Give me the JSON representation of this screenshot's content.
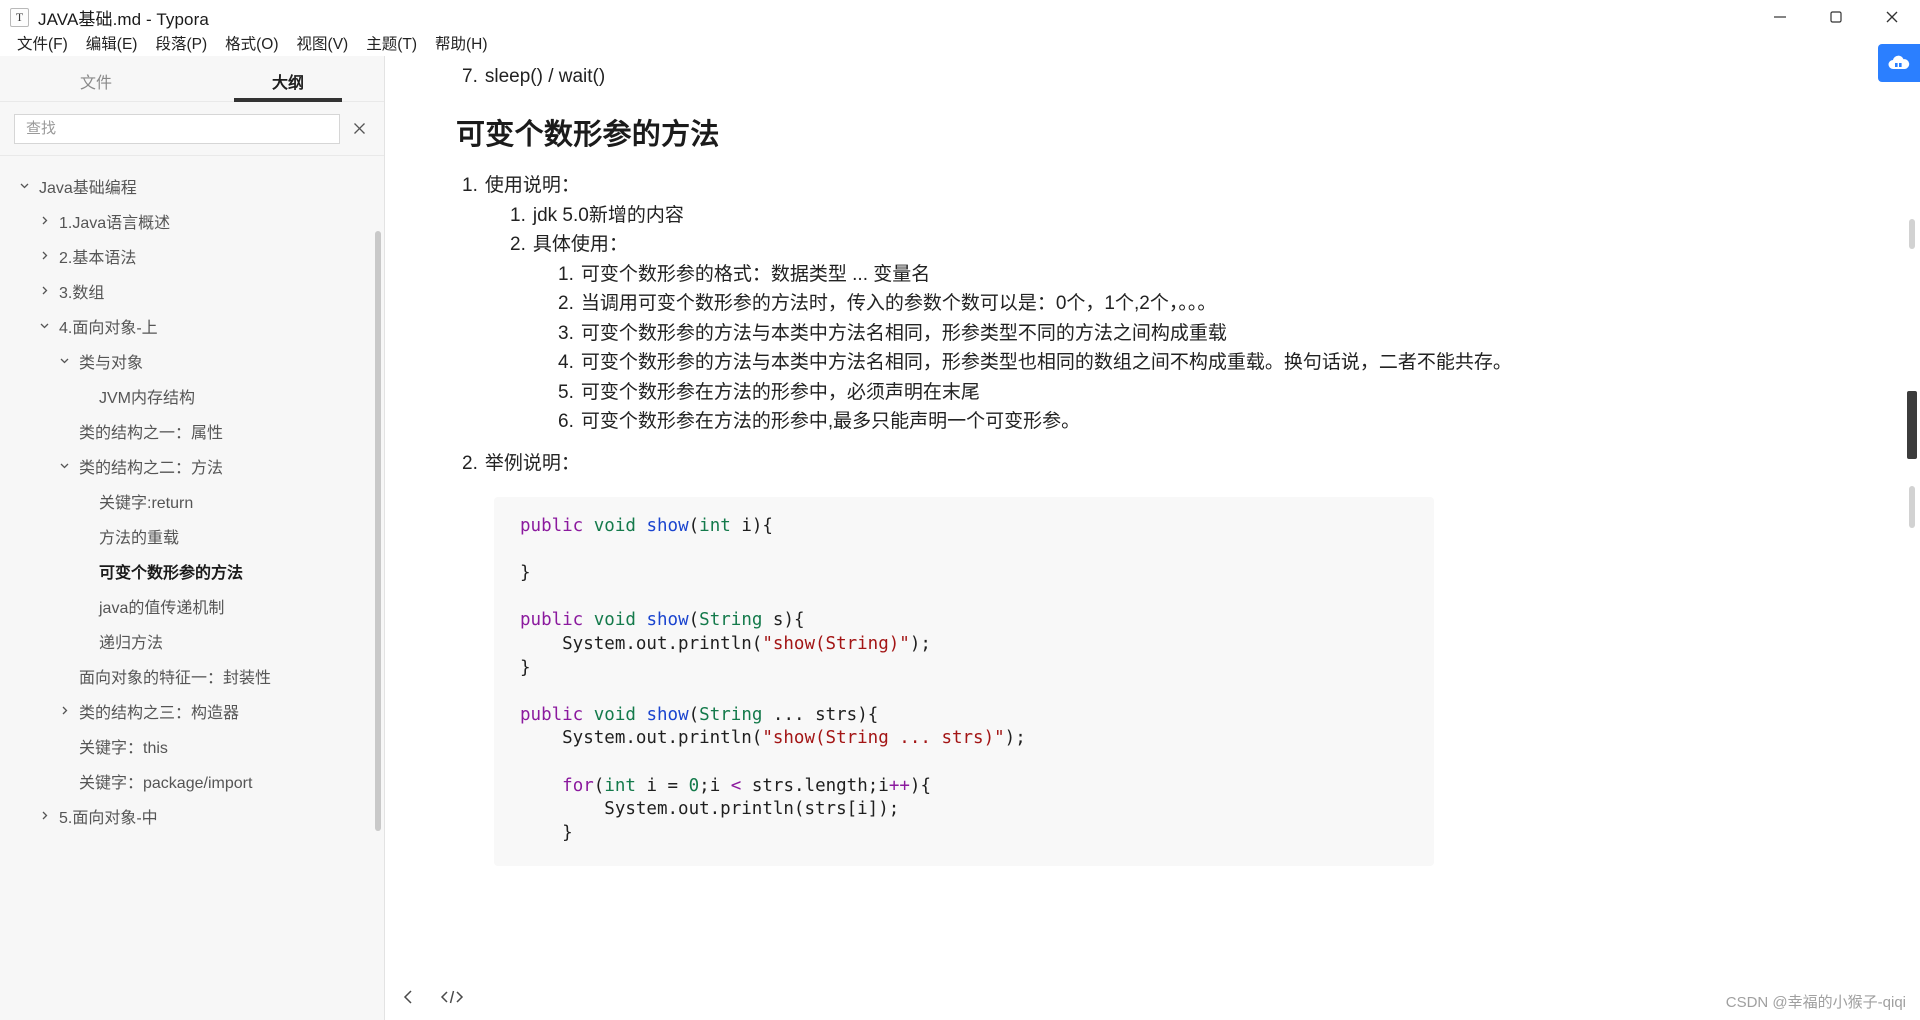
{
  "window": {
    "title": "JAVA基础.md - Typora",
    "doc_icon_letter": "T",
    "controls": {
      "minimize": "minimize-icon",
      "maximize": "maximize-icon",
      "close": "close-icon"
    }
  },
  "menubar": {
    "items": [
      {
        "label": "文件(F)",
        "name": "menu-file"
      },
      {
        "label": "编辑(E)",
        "name": "menu-edit"
      },
      {
        "label": "段落(P)",
        "name": "menu-paragraph"
      },
      {
        "label": "格式(O)",
        "name": "menu-format"
      },
      {
        "label": "视图(V)",
        "name": "menu-view"
      },
      {
        "label": "主题(T)",
        "name": "menu-theme"
      },
      {
        "label": "帮助(H)",
        "name": "menu-help"
      }
    ]
  },
  "sidebar": {
    "tabs": [
      {
        "label": "文件",
        "active": false
      },
      {
        "label": "大纲",
        "active": true
      }
    ],
    "search": {
      "placeholder": "查找",
      "value": "",
      "close_icon": "close-icon"
    },
    "tree": [
      {
        "label": "Java基础编程",
        "depth": 0,
        "caret": "down",
        "active": false
      },
      {
        "label": "1.Java语言概述",
        "depth": 1,
        "caret": "right",
        "active": false
      },
      {
        "label": "2.基本语法",
        "depth": 1,
        "caret": "right",
        "active": false
      },
      {
        "label": "3.数组",
        "depth": 1,
        "caret": "right",
        "active": false
      },
      {
        "label": "4.面向对象-上",
        "depth": 1,
        "caret": "down",
        "active": false
      },
      {
        "label": "类与对象",
        "depth": 2,
        "caret": "down",
        "active": false
      },
      {
        "label": "JVM内存结构",
        "depth": 3,
        "caret": "none",
        "active": false
      },
      {
        "label": "类的结构之一：属性",
        "depth": 2,
        "caret": "none",
        "active": false
      },
      {
        "label": "类的结构之二：方法",
        "depth": 2,
        "caret": "down",
        "active": false
      },
      {
        "label": "关键字:return",
        "depth": 3,
        "caret": "none",
        "active": false
      },
      {
        "label": "方法的重载",
        "depth": 3,
        "caret": "none",
        "active": false
      },
      {
        "label": "可变个数形参的方法",
        "depth": 3,
        "caret": "none",
        "active": true
      },
      {
        "label": "java的值传递机制",
        "depth": 3,
        "caret": "none",
        "active": false
      },
      {
        "label": "递归方法",
        "depth": 3,
        "caret": "none",
        "active": false
      },
      {
        "label": "面向对象的特征一：封装性",
        "depth": 2,
        "caret": "none",
        "active": false
      },
      {
        "label": "类的结构之三：构造器",
        "depth": 2,
        "caret": "right",
        "active": false
      },
      {
        "label": "关键字：this",
        "depth": 2,
        "caret": "none",
        "active": false
      },
      {
        "label": "关键字：package/import",
        "depth": 2,
        "caret": "none",
        "active": false
      },
      {
        "label": "5.面向对象-中",
        "depth": 1,
        "caret": "right",
        "active": false
      }
    ]
  },
  "document": {
    "prev_item": {
      "num": "7.",
      "text": "sleep() / wait()"
    },
    "heading": "可变个数形参的方法",
    "sections": [
      {
        "num": "1.",
        "text": "使用说明：",
        "children": [
          {
            "num": "1.",
            "text": "jdk 5.0新增的内容",
            "children": []
          },
          {
            "num": "2.",
            "text": "具体使用：",
            "children": [
              {
                "num": "1.",
                "text": "可变个数形参的格式：数据类型 ... 变量名"
              },
              {
                "num": "2.",
                "text": "当调用可变个数形参的方法时，传入的参数个数可以是：0个，1个,2个，。。。"
              },
              {
                "num": "3.",
                "text": "可变个数形参的方法与本类中方法名相同，形参类型不同的方法之间构成重载"
              },
              {
                "num": "4.",
                "text": "可变个数形参的方法与本类中方法名相同，形参类型也相同的数组之间不构成重载。换句话说，二者不能共存。"
              },
              {
                "num": "5.",
                "text": "可变个数形参在方法的形参中，必须声明在末尾"
              },
              {
                "num": "6.",
                "text": "可变个数形参在方法的形参中,最多只能声明一个可变形参。"
              }
            ]
          }
        ]
      },
      {
        "num": "2.",
        "text": "举例说明：",
        "children": []
      }
    ],
    "code": {
      "language": "java",
      "lines": [
        [
          {
            "t": "public",
            "c": "k-kw"
          },
          {
            "t": " ",
            "c": "k-plain"
          },
          {
            "t": "void",
            "c": "k-type"
          },
          {
            "t": " ",
            "c": "k-plain"
          },
          {
            "t": "show",
            "c": "k-fn"
          },
          {
            "t": "(",
            "c": "k-plain"
          },
          {
            "t": "int",
            "c": "k-type"
          },
          {
            "t": " i){",
            "c": "k-plain"
          }
        ],
        [],
        [
          {
            "t": "}",
            "c": "k-plain"
          }
        ],
        [],
        [
          {
            "t": "public",
            "c": "k-kw"
          },
          {
            "t": " ",
            "c": "k-plain"
          },
          {
            "t": "void",
            "c": "k-type"
          },
          {
            "t": " ",
            "c": "k-plain"
          },
          {
            "t": "show",
            "c": "k-fn"
          },
          {
            "t": "(",
            "c": "k-plain"
          },
          {
            "t": "String",
            "c": "k-type"
          },
          {
            "t": " s){",
            "c": "k-plain"
          }
        ],
        [
          {
            "t": "    System.out.println(",
            "c": "k-plain"
          },
          {
            "t": "\"show(String)\"",
            "c": "k-str"
          },
          {
            "t": ");",
            "c": "k-plain"
          }
        ],
        [
          {
            "t": "}",
            "c": "k-plain"
          }
        ],
        [],
        [
          {
            "t": "public",
            "c": "k-kw"
          },
          {
            "t": " ",
            "c": "k-plain"
          },
          {
            "t": "void",
            "c": "k-type"
          },
          {
            "t": " ",
            "c": "k-plain"
          },
          {
            "t": "show",
            "c": "k-fn"
          },
          {
            "t": "(",
            "c": "k-plain"
          },
          {
            "t": "String",
            "c": "k-type"
          },
          {
            "t": " ... strs){",
            "c": "k-plain"
          }
        ],
        [
          {
            "t": "    System.out.println(",
            "c": "k-plain"
          },
          {
            "t": "\"show(String ... strs)\"",
            "c": "k-str"
          },
          {
            "t": ");",
            "c": "k-plain"
          }
        ],
        [],
        [
          {
            "t": "    ",
            "c": "k-plain"
          },
          {
            "t": "for",
            "c": "k-ctrl"
          },
          {
            "t": "(",
            "c": "k-plain"
          },
          {
            "t": "int",
            "c": "k-type"
          },
          {
            "t": " i = ",
            "c": "k-plain"
          },
          {
            "t": "0",
            "c": "k-num"
          },
          {
            "t": ";i ",
            "c": "k-plain"
          },
          {
            "t": "<",
            "c": "k-ctrl"
          },
          {
            "t": " strs.length;i",
            "c": "k-plain"
          },
          {
            "t": "++",
            "c": "k-ctrl"
          },
          {
            "t": "){",
            "c": "k-plain"
          }
        ],
        [
          {
            "t": "        System.out.println(strs[i]);",
            "c": "k-plain"
          }
        ],
        [
          {
            "t": "    }",
            "c": "k-plain"
          }
        ]
      ]
    }
  },
  "bottombar": {
    "buttons": [
      {
        "name": "sidebar-toggle-button",
        "icon": "chevron-left-icon"
      },
      {
        "name": "source-code-mode-button",
        "icon": "code-tags-icon"
      }
    ]
  },
  "overlays": {
    "cloud_badge": "cloud-sync-icon",
    "watermark": "CSDN @幸福的小猴子-qiqi"
  }
}
